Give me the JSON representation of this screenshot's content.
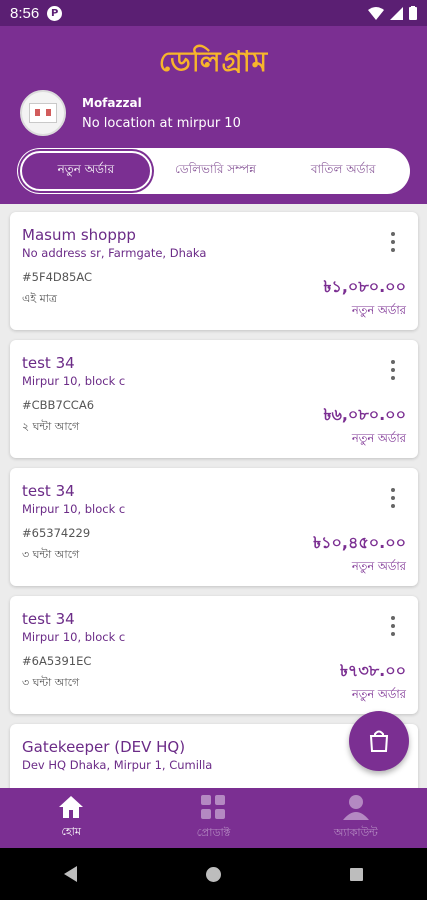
{
  "status_bar": {
    "time": "8:56",
    "app_icon": "P"
  },
  "header": {
    "brand": "ডেলিগ্রাম",
    "user_name": "Mofazzal",
    "location": "No location at mirpur 10"
  },
  "tabs": [
    {
      "label": "নতুন অর্ডার",
      "active": true
    },
    {
      "label": "ডেলিভারি সম্পন্ন",
      "active": false
    },
    {
      "label": "বাতিল অর্ডার",
      "active": false
    }
  ],
  "orders": [
    {
      "title": "Masum shoppp",
      "address": "No address sr, Farmgate, Dhaka",
      "code": "#5F4D85AC",
      "time": "এই মাত্র",
      "price": "৳১,০৮০.০০",
      "status": "নতুন অর্ডার"
    },
    {
      "title": "test 34",
      "address": "Mirpur 10, block c",
      "code": "#CBB7CCA6",
      "time": "২ ঘন্টা আগে",
      "price": "৳৬,০৮০.০০",
      "status": "নতুন অর্ডার"
    },
    {
      "title": "test 34",
      "address": "Mirpur 10, block c",
      "code": "#65374229",
      "time": "৩ ঘন্টা আগে",
      "price": "৳১০,৪৫০.০০",
      "status": "নতুন অর্ডার"
    },
    {
      "title": "test 34",
      "address": "Mirpur 10, block c",
      "code": "#6A5391EC",
      "time": "৩ ঘন্টা আগে",
      "price": "৳৭৩৮.০০",
      "status": "নতুন অর্ডার"
    },
    {
      "title": "Gatekeeper (DEV HQ)",
      "address": "Dev HQ Dhaka, Mirpur 1, Cumilla",
      "code": "",
      "time": "",
      "price": "",
      "status": ""
    }
  ],
  "bottom_nav": [
    {
      "label": "হোম",
      "icon": "home-icon",
      "active": true
    },
    {
      "label": "প্রোডাক্ট",
      "icon": "grid-icon",
      "active": false
    },
    {
      "label": "অ্যাকাউন্ট",
      "icon": "person-icon",
      "active": false
    }
  ],
  "colors": {
    "primary": "#7b2f92",
    "brand": "#f7b52b"
  }
}
